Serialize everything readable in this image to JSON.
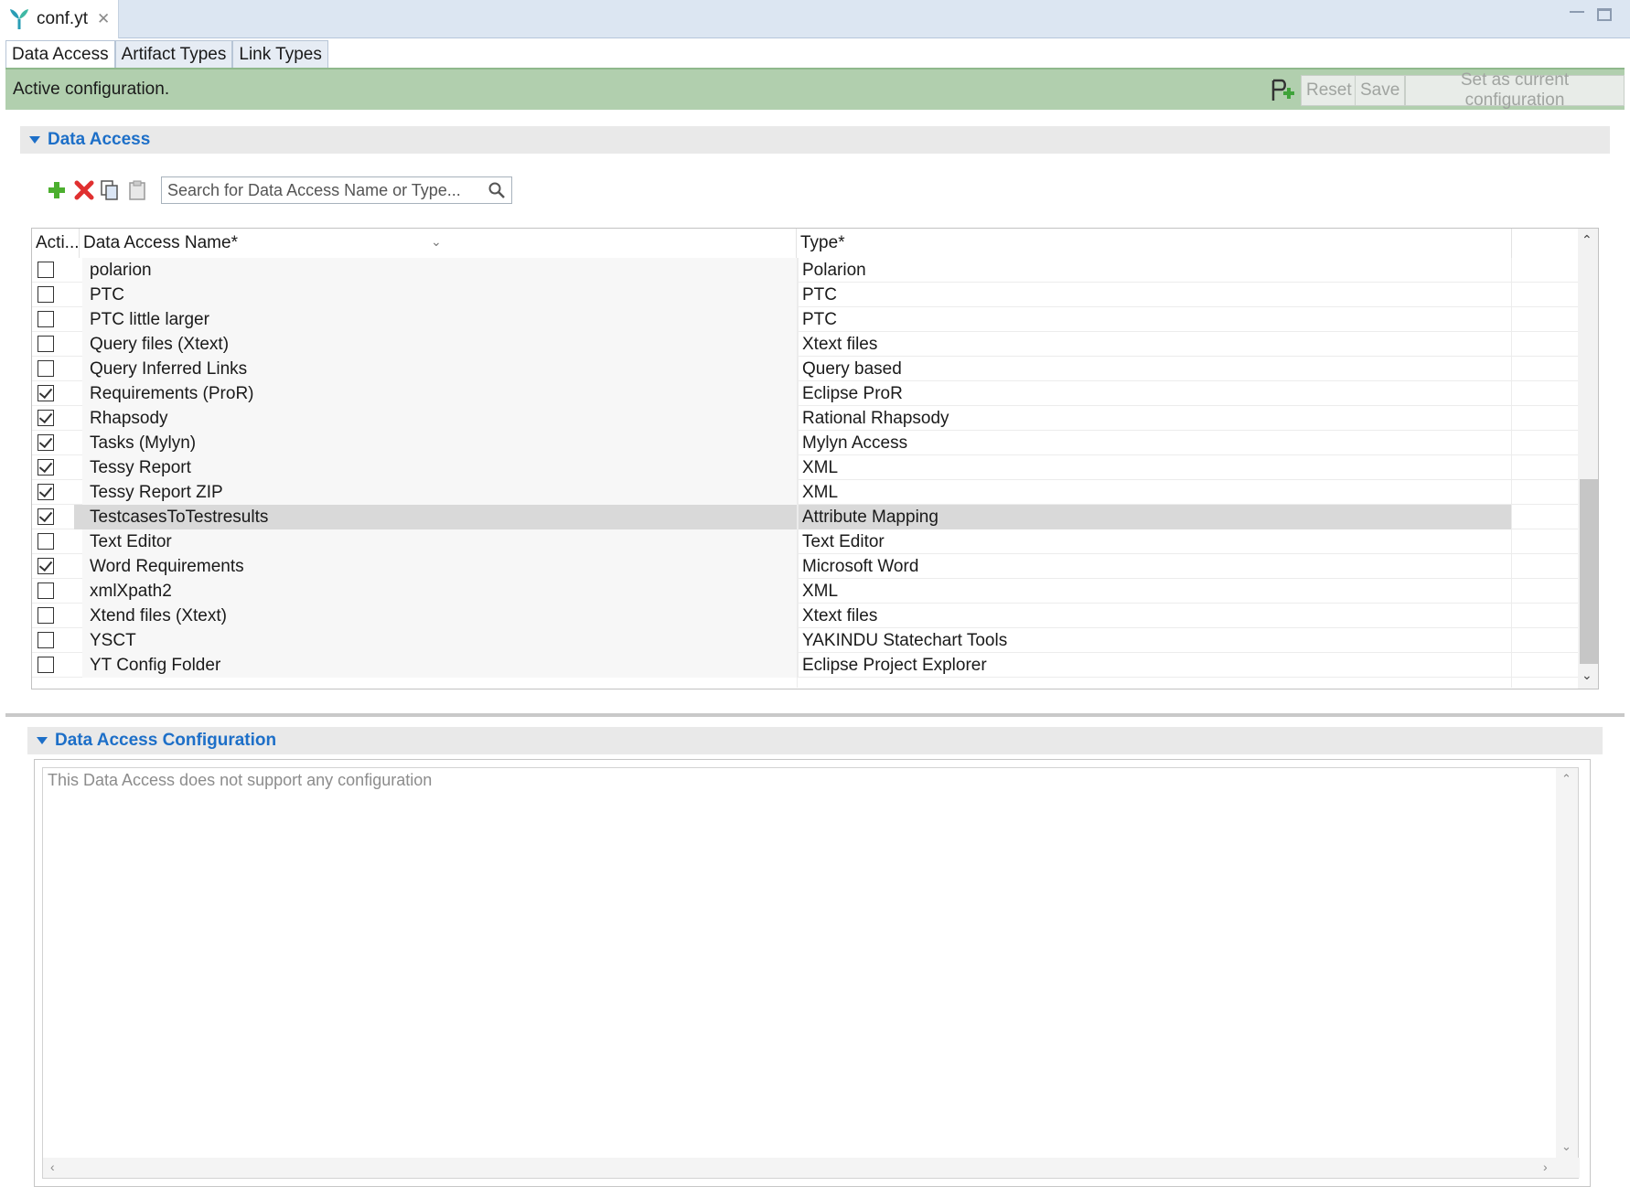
{
  "editor": {
    "tab_title": "conf.yt"
  },
  "form_tabs": [
    "Data Access",
    "Artifact Types",
    "Link Types"
  ],
  "header": {
    "status": "Active configuration.",
    "reset_label": "Reset",
    "save_label": "Save",
    "set_current_label": "Set as current configuration"
  },
  "data_access_section": {
    "title": "Data Access",
    "search_placeholder": "Search for Data Access Name or Type...",
    "columns": {
      "active": "Acti...",
      "name": "Data Access Name*",
      "type": "Type*"
    },
    "rows": [
      {
        "active": false,
        "name": "polarion",
        "type": "Polarion"
      },
      {
        "active": false,
        "name": "PTC",
        "type": "PTC"
      },
      {
        "active": false,
        "name": "PTC little larger",
        "type": "PTC"
      },
      {
        "active": false,
        "name": "Query files (Xtext)",
        "type": "Xtext files"
      },
      {
        "active": false,
        "name": "Query Inferred Links",
        "type": "Query based"
      },
      {
        "active": true,
        "name": "Requirements (ProR)",
        "type": "Eclipse ProR"
      },
      {
        "active": true,
        "name": "Rhapsody",
        "type": "Rational Rhapsody"
      },
      {
        "active": true,
        "name": "Tasks (Mylyn)",
        "type": "Mylyn Access"
      },
      {
        "active": true,
        "name": "Tessy Report",
        "type": "XML"
      },
      {
        "active": true,
        "name": "Tessy Report ZIP",
        "type": "XML"
      },
      {
        "active": true,
        "name": "TestcasesToTestresults",
        "type": "Attribute Mapping",
        "selected": true
      },
      {
        "active": false,
        "name": "Text Editor",
        "type": "Text Editor"
      },
      {
        "active": true,
        "name": "Word Requirements",
        "type": "Microsoft Word"
      },
      {
        "active": false,
        "name": "xmlXpath2",
        "type": "XML"
      },
      {
        "active": false,
        "name": "Xtend files (Xtext)",
        "type": "Xtext files"
      },
      {
        "active": false,
        "name": "YSCT",
        "type": "YAKINDU Statechart Tools"
      },
      {
        "active": false,
        "name": "YT Config Folder",
        "type": "Eclipse Project Explorer"
      }
    ]
  },
  "config_section": {
    "title": "Data Access Configuration",
    "message": "This Data Access does not support any configuration"
  },
  "colors": {
    "accent": "#1d6fc8",
    "status_bar": "#b1cfae",
    "selection": "#d9d9d9"
  }
}
